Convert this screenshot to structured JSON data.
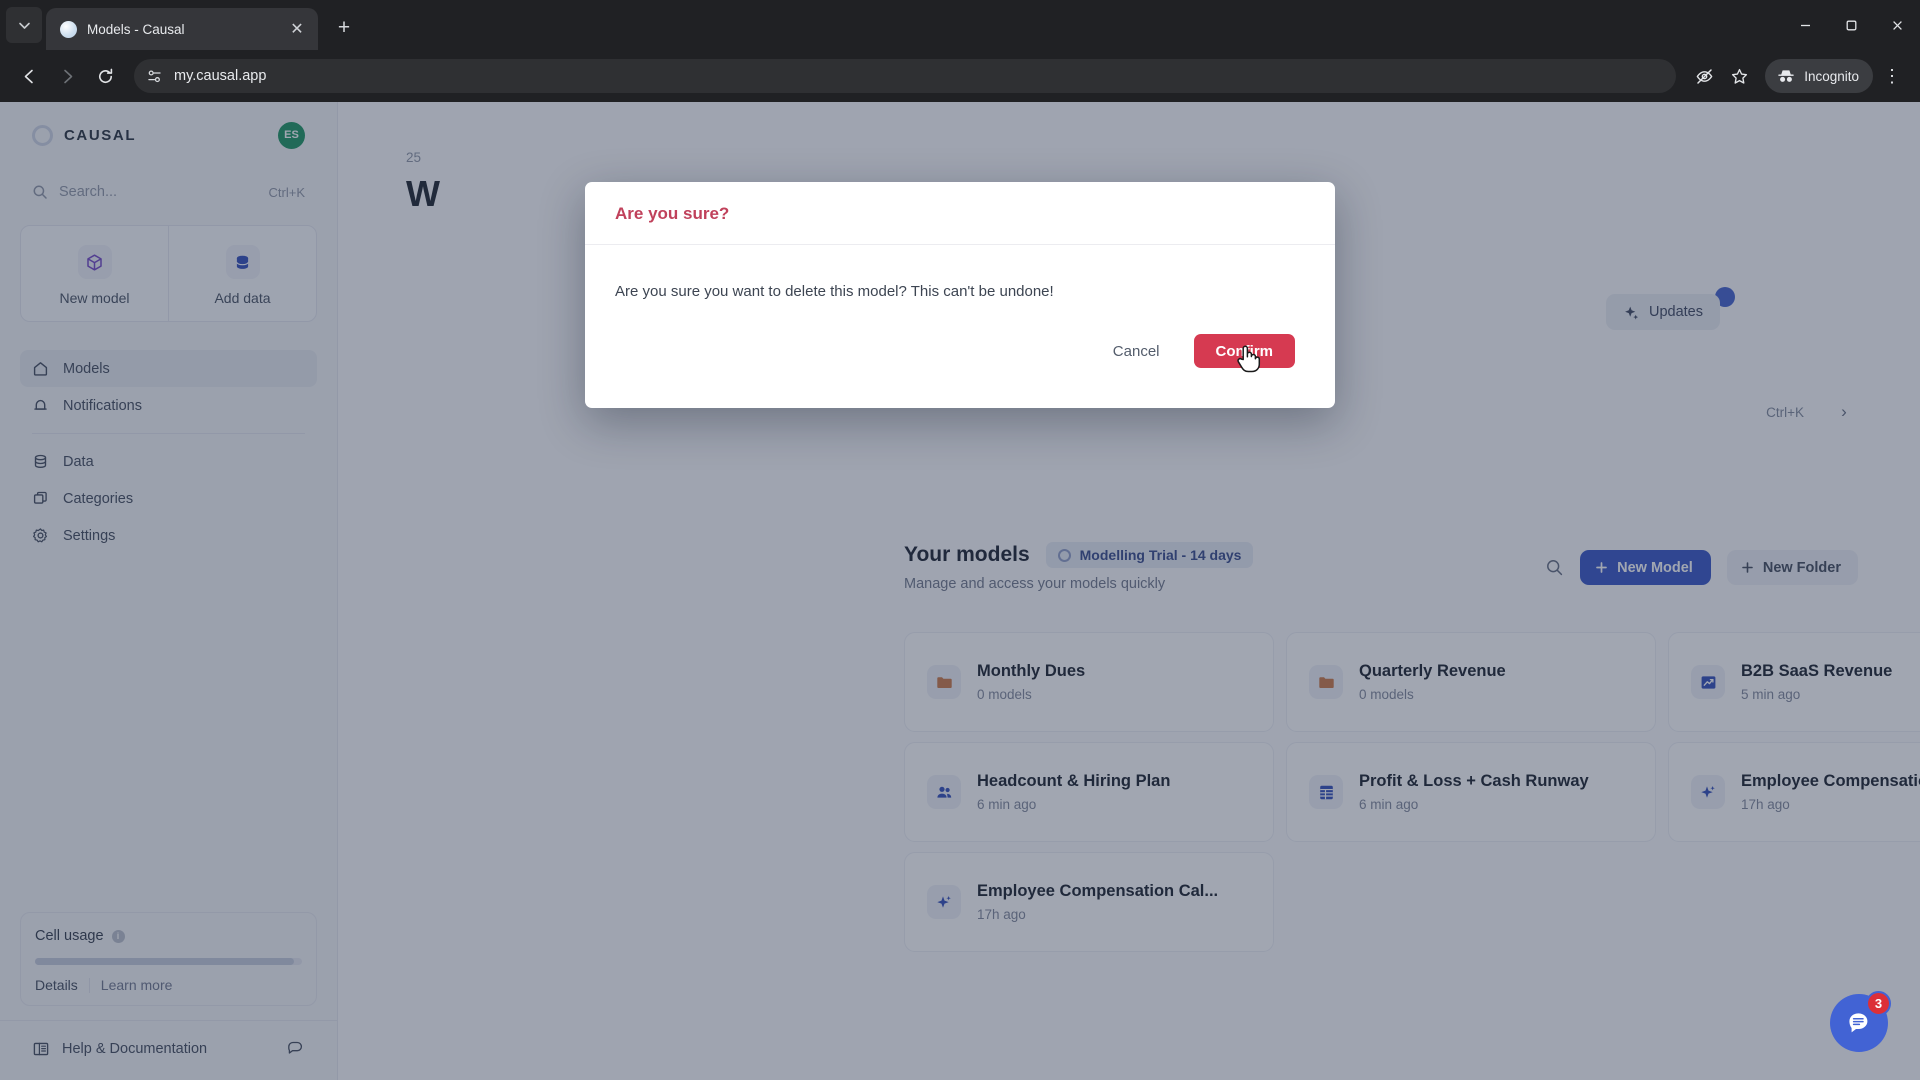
{
  "browser": {
    "tab": {
      "title": "Models - Causal",
      "favicon": "globe-icon",
      "close": "✕"
    },
    "tab_list_chevron": "⌄",
    "new_tab": "+",
    "window": {
      "minimize": "—",
      "maximize": "❐",
      "close": "✕"
    },
    "nav": {
      "back": "←",
      "forward": "→",
      "reload": "⟳"
    },
    "omnibox": {
      "url": "my.causal.app",
      "site_info_icon": "tune-icon"
    },
    "toolbar": {
      "eye_off": "eye-off-icon",
      "bookmark": "star-icon",
      "incognito_label": "Incognito",
      "menu": "⋮"
    }
  },
  "sidebar": {
    "brand": {
      "name": "CAUSAL",
      "avatar_initials": "ES"
    },
    "search": {
      "placeholder": "Search...",
      "shortcut": "Ctrl+K"
    },
    "quick_actions": [
      {
        "label": "New model",
        "icon": "cube-icon"
      },
      {
        "label": "Add data",
        "icon": "database-icon"
      }
    ],
    "nav_items": [
      {
        "label": "Models",
        "icon": "home-icon",
        "active": true
      },
      {
        "label": "Notifications",
        "icon": "bell-icon",
        "active": false
      },
      {
        "label": "Data",
        "icon": "database-icon",
        "active": false
      },
      {
        "label": "Categories",
        "icon": "copy-icon",
        "active": false
      },
      {
        "label": "Settings",
        "icon": "gear-icon",
        "active": false
      }
    ],
    "usage": {
      "title": "Cell usage",
      "info_icon": "info-icon",
      "progress_percent": 97,
      "details_label": "Details",
      "learn_more_label": "Learn more"
    },
    "help": {
      "label": "Help & Documentation",
      "book_icon": "book-icon",
      "chat_icon": "chat-icon"
    }
  },
  "main": {
    "breadcrumb": "25",
    "greeting": "W",
    "updates_button": {
      "label": "Updates",
      "icon": "sparkle-icon",
      "has_badge": true
    },
    "ask_bar": {
      "shortcut": "Ctrl+K",
      "chevron": "›"
    },
    "models_header": {
      "title": "Your models",
      "trial_badge": "Modelling Trial - 14 days",
      "subtitle": "Manage and access your models quickly"
    },
    "actions": {
      "search_icon": "search-icon",
      "new_model": "New Model",
      "new_folder": "New Folder",
      "plus": "+"
    },
    "cards": [
      {
        "name": "Monthly Dues",
        "meta": "0 models",
        "icon": "folder-icon",
        "kind": "folder"
      },
      {
        "name": "Quarterly Revenue",
        "meta": "0 models",
        "icon": "folder-icon",
        "kind": "folder"
      },
      {
        "name": "B2B SaaS Revenue",
        "meta": "5 min ago",
        "icon": "chart-icon",
        "kind": "model"
      },
      {
        "name": "Headcount & Hiring Plan",
        "meta": "6 min ago",
        "icon": "people-icon",
        "kind": "model"
      },
      {
        "name": "Profit & Loss + Cash Runway",
        "meta": "6 min ago",
        "icon": "table-icon",
        "kind": "model"
      },
      {
        "name": "Employee Compensation Cal...",
        "meta": "17h ago",
        "icon": "sparkle-icon",
        "kind": "model"
      },
      {
        "name": "Employee Compensation Cal...",
        "meta": "17h ago",
        "icon": "sparkle-icon",
        "kind": "model"
      }
    ],
    "chat_fab": {
      "icon": "chat-icon",
      "badge": "3"
    }
  },
  "modal": {
    "title": "Are you sure?",
    "message": "Are you sure you want to delete this model? This can't be undone!",
    "cancel_label": "Cancel",
    "confirm_label": "Confirm"
  },
  "colors": {
    "accent_blue": "#2f4fc4",
    "danger_red": "#d63a51",
    "modal_title_red": "#c0415b",
    "avatar_green": "#14915c",
    "badge_red": "#dc2f38",
    "chat_blue": "#4263d4"
  }
}
